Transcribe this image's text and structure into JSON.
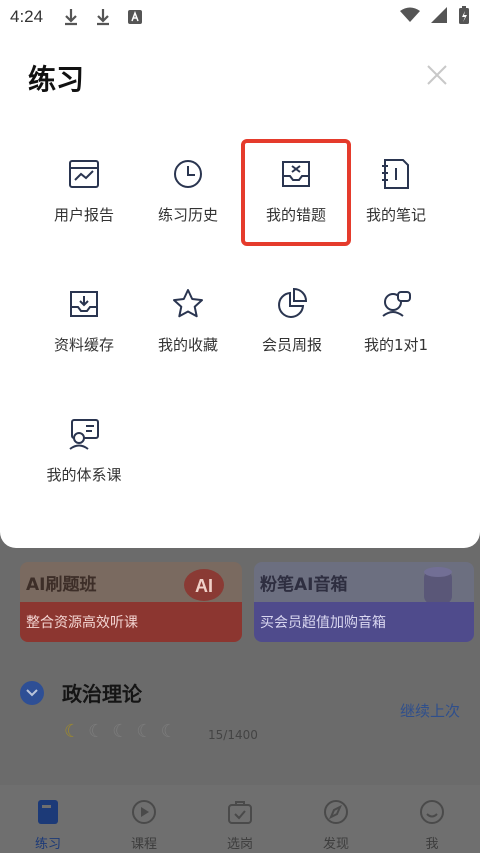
{
  "status_bar": {
    "time": "4:24"
  },
  "sheet": {
    "title": "练习",
    "items": [
      {
        "label": "用户报告",
        "icon": "report-chart-icon"
      },
      {
        "label": "练习历史",
        "icon": "clock-icon"
      },
      {
        "label": "我的错题",
        "icon": "wrong-questions-tray-icon"
      },
      {
        "label": "我的笔记",
        "icon": "notebook-icon"
      },
      {
        "label": "资料缓存",
        "icon": "download-tray-icon"
      },
      {
        "label": "我的收藏",
        "icon": "star-icon"
      },
      {
        "label": "会员周报",
        "icon": "pie-chart-icon"
      },
      {
        "label": "我的1对1",
        "icon": "one-on-one-chat-icon"
      },
      {
        "label": "我的体系课",
        "icon": "course-board-icon"
      }
    ],
    "highlight_color": "#e53b2c"
  },
  "background": {
    "card1": {
      "title": "AI刷题班",
      "subtitle": "整合资源高效听课",
      "badge": "AI"
    },
    "card2": {
      "title": "粉笔AI音箱",
      "subtitle": "买会员超值加购音箱"
    },
    "subject": {
      "name": "政治理论",
      "continue": "继续上次",
      "progress": "15/1400"
    }
  },
  "tabbar": {
    "tabs": [
      {
        "label": "练习",
        "active": true
      },
      {
        "label": "课程",
        "active": false
      },
      {
        "label": "选岗",
        "active": false
      },
      {
        "label": "发现",
        "active": false
      },
      {
        "label": "我",
        "active": false
      }
    ]
  }
}
